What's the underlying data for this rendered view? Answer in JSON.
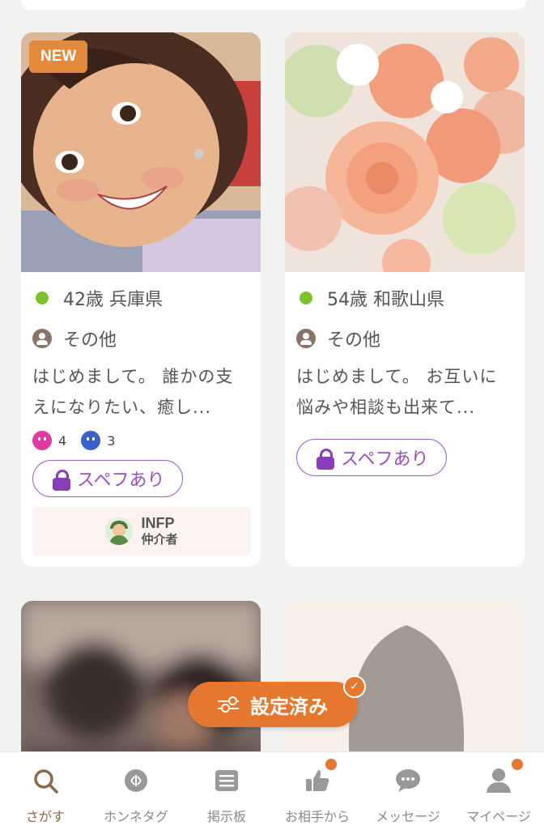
{
  "colors": {
    "accent": "#e5782e",
    "online": "#7cc32b",
    "spec": "#9b4fc4"
  },
  "cards": [
    {
      "badge": "NEW",
      "age_location": "42歳 兵庫県",
      "group": "その他",
      "bio": "はじめまして。 誰かの支えになりたい、癒し...",
      "reactions": {
        "happy": "4",
        "sad": "3"
      },
      "spec_label": "スペフあり",
      "mbti": {
        "type": "INFP",
        "label": "仲介者"
      }
    },
    {
      "age_location": "54歳 和歌山県",
      "group": "その他",
      "bio": "はじめまして。 お互いに悩みや相談も出来て...",
      "spec_label": "スペフあり"
    }
  ],
  "filter_button": {
    "label": "設定済み",
    "icon": "sliders-icon",
    "status_icon": "check-icon"
  },
  "tabbar": {
    "items": [
      {
        "label": "さがす",
        "icon": "search-icon",
        "active": true
      },
      {
        "label": "ホンネタグ",
        "icon": "tag-icon"
      },
      {
        "label": "掲示板",
        "icon": "board-icon"
      },
      {
        "label": "お相手から",
        "icon": "thumbs-up-icon",
        "notification": true
      },
      {
        "label": "メッセージ",
        "icon": "message-icon"
      },
      {
        "label": "マイページ",
        "icon": "person-icon",
        "notification": true
      }
    ]
  }
}
